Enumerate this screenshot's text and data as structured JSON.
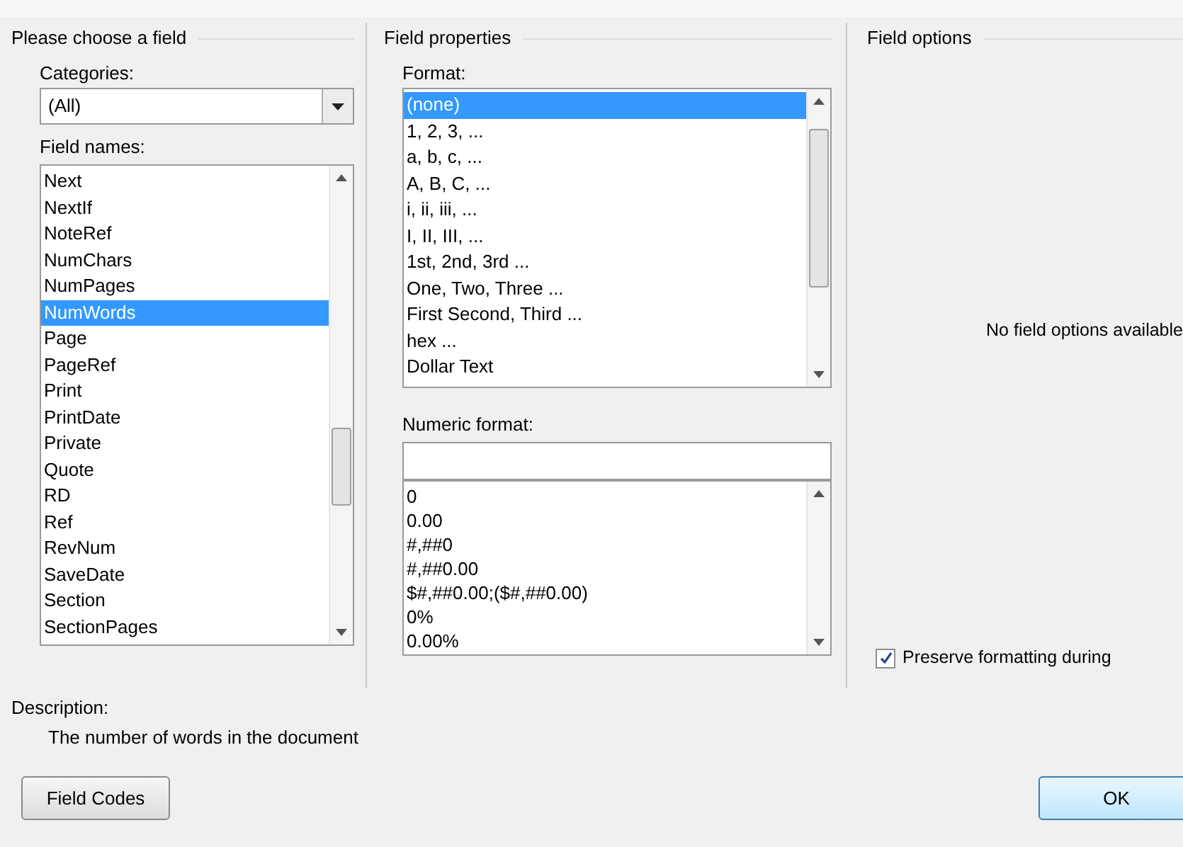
{
  "choose_group": {
    "title": "Please choose a field",
    "categories": {
      "label": "Categories:",
      "value": "(All)"
    },
    "field_names": {
      "label": "Field names:",
      "items": [
        {
          "text": "Next",
          "selected": false
        },
        {
          "text": "NextIf",
          "selected": false
        },
        {
          "text": "NoteRef",
          "selected": false
        },
        {
          "text": "NumChars",
          "selected": false
        },
        {
          "text": "NumPages",
          "selected": false
        },
        {
          "text": "NumWords",
          "selected": true
        },
        {
          "text": "Page",
          "selected": false
        },
        {
          "text": "PageRef",
          "selected": false
        },
        {
          "text": "Print",
          "selected": false
        },
        {
          "text": "PrintDate",
          "selected": false
        },
        {
          "text": "Private",
          "selected": false
        },
        {
          "text": "Quote",
          "selected": false
        },
        {
          "text": "RD",
          "selected": false
        },
        {
          "text": "Ref",
          "selected": false
        },
        {
          "text": "RevNum",
          "selected": false
        },
        {
          "text": "SaveDate",
          "selected": false
        },
        {
          "text": "Section",
          "selected": false
        },
        {
          "text": "SectionPages",
          "selected": false
        }
      ]
    }
  },
  "properties_group": {
    "title": "Field properties",
    "format": {
      "label": "Format:",
      "items": [
        {
          "text": "(none)",
          "selected": true
        },
        {
          "text": "1, 2, 3, ...",
          "selected": false
        },
        {
          "text": "a, b, c, ...",
          "selected": false
        },
        {
          "text": "A, B, C, ...",
          "selected": false
        },
        {
          "text": "i, ii, iii, ...",
          "selected": false
        },
        {
          "text": "I, II, III, ...",
          "selected": false
        },
        {
          "text": "1st, 2nd, 3rd ...",
          "selected": false
        },
        {
          "text": "One, Two, Three ...",
          "selected": false
        },
        {
          "text": "First Second, Third ...",
          "selected": false
        },
        {
          "text": "hex ...",
          "selected": false
        },
        {
          "text": "Dollar Text",
          "selected": false
        }
      ]
    },
    "numeric_format": {
      "label": "Numeric format:",
      "items": [
        "0",
        "0.00",
        "#,##0",
        "#,##0.00",
        "$#,##0.00;($#,##0.00)",
        "0%",
        "0.00%"
      ]
    }
  },
  "options_group": {
    "title": "Field options",
    "message": "No field options available",
    "preserve": {
      "label": "Preserve formatting during",
      "checked": true
    }
  },
  "description": {
    "label": "Description:",
    "text": "The number of words in the document"
  },
  "buttons": {
    "field_codes": "Field Codes",
    "ok": "OK"
  }
}
